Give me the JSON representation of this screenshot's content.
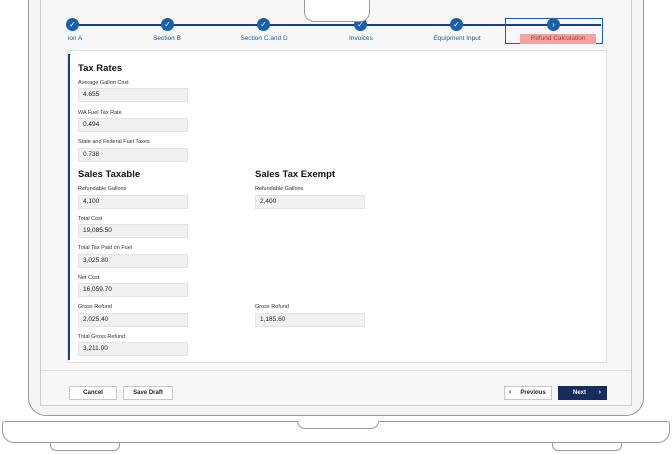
{
  "stepper": {
    "steps": [
      {
        "label": "ion A",
        "icon": "check-icon"
      },
      {
        "label": "Section B",
        "icon": "check-icon"
      },
      {
        "label": "Section C and D",
        "icon": "check-icon"
      },
      {
        "label": "Invoices",
        "icon": "check-icon"
      },
      {
        "label": "Equipment Input",
        "icon": "check-icon"
      },
      {
        "label": "Refund Calculation",
        "icon": "chevron-right-icon"
      }
    ],
    "current_highlight": "#f2a3a3"
  },
  "tax_rates": {
    "title": "Tax Rates",
    "average_gallon_cost": {
      "label": "Average Gallon Cost",
      "value": "4.655"
    },
    "wa_fuel_tax_rate": {
      "label": "WA Fuel Tax Rate",
      "value": "0.494"
    },
    "state_federal_fuel_taxes": {
      "label": "State and Federal Fuel Taxes",
      "value": "0.738"
    }
  },
  "sales_taxable": {
    "title": "Sales Taxable",
    "refundable_gallons": {
      "label": "Refundable Gallons",
      "value": "4,100"
    },
    "total_cost": {
      "label": "Total Cost",
      "value": "19,085.50"
    },
    "total_tax_paid": {
      "label": "Total Tax Paid on Fuel",
      "value": "3,025.80"
    },
    "net_cost": {
      "label": "Net Cost",
      "value": "16,059.70"
    },
    "gross_refund": {
      "label": "Gross Refund",
      "value": "2,025.40"
    },
    "total_gross_refund": {
      "label": "Total Gross Refund",
      "value": "3,211.00"
    }
  },
  "sales_tax_exempt": {
    "title": "Sales Tax Exempt",
    "refundable_gallons": {
      "label": "Refundable Gallons",
      "value": "2,400"
    },
    "gross_refund": {
      "label": "Gross Refund",
      "value": "1,185.60"
    }
  },
  "footer": {
    "cancel": "Cancel",
    "save_draft": "Save Draft",
    "previous": "Previous",
    "next": "Next",
    "prev_icon": "chevron-left-icon",
    "next_icon": "chevron-right-icon"
  },
  "colors": {
    "accent": "#1b5fa8",
    "dark": "#172c5a"
  }
}
